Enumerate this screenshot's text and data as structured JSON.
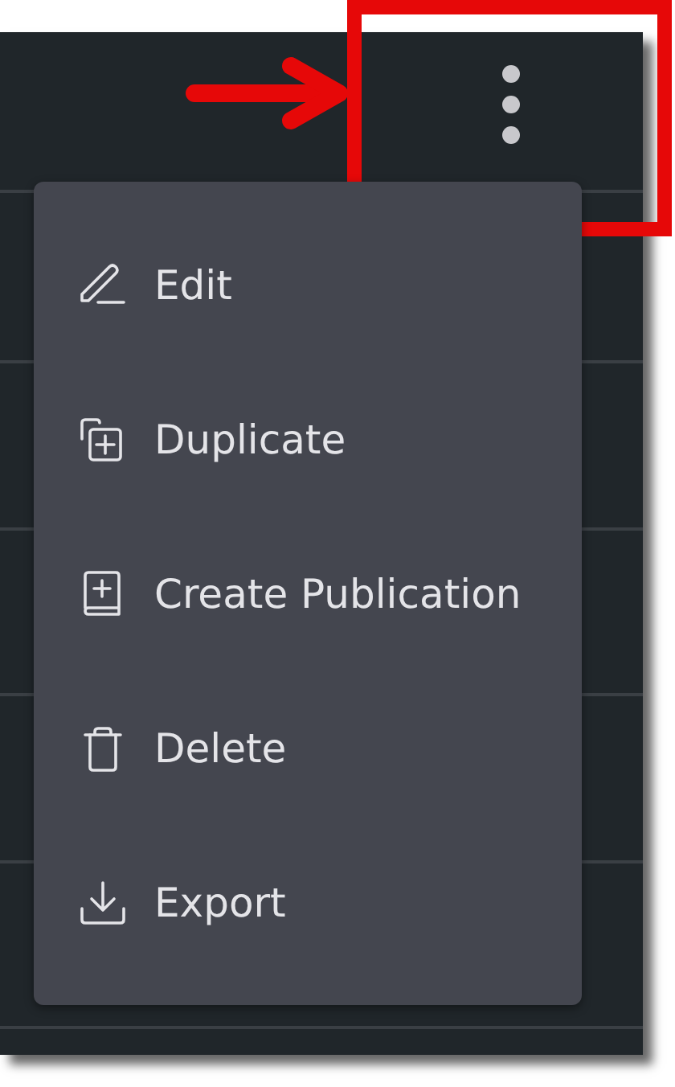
{
  "menu": {
    "items": [
      {
        "kind": "edit",
        "label": "Edit"
      },
      {
        "kind": "duplicate",
        "label": "Duplicate"
      },
      {
        "kind": "publication",
        "label": "Create Publication"
      },
      {
        "kind": "delete",
        "label": "Delete"
      },
      {
        "kind": "export",
        "label": "Export"
      }
    ]
  }
}
